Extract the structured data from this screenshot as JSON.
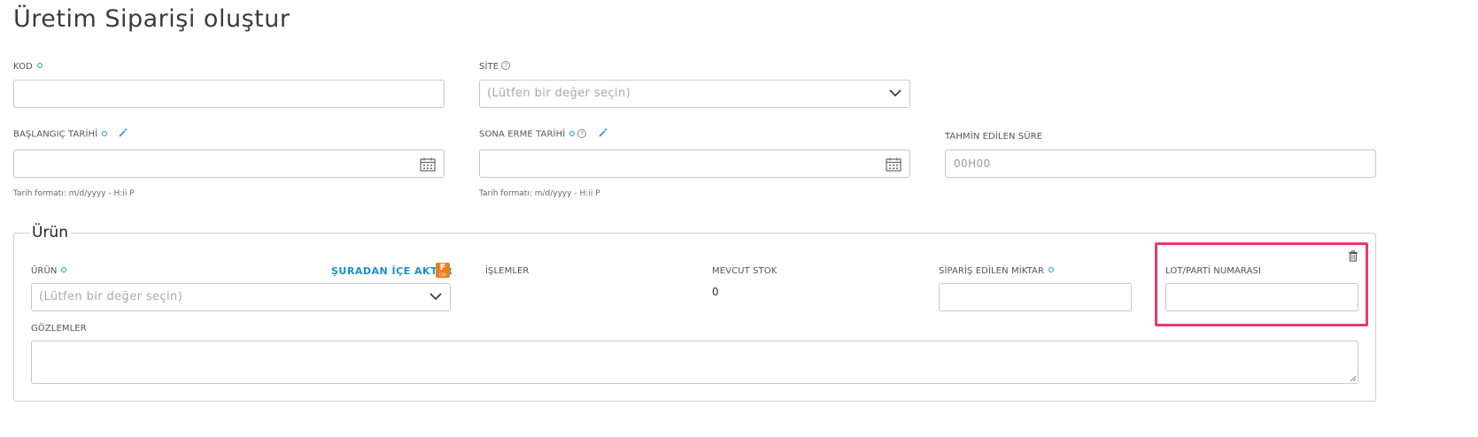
{
  "page": {
    "title": "Üretim Siparişi oluştur"
  },
  "form": {
    "kod": {
      "label": "KOD",
      "value": ""
    },
    "site": {
      "label": "SİTE",
      "placeholder": "(Lütfen bir değer seçin)"
    },
    "start_date": {
      "label": "BAŞLANGIÇ TARİHİ",
      "value": "",
      "hint": "Tarih formatı: m/d/yyyy - H:ii P"
    },
    "end_date": {
      "label": "SONA ERME TARİHİ",
      "value": "",
      "hint": "Tarih formatı: m/d/yyyy - H:ii P"
    },
    "estimated_duration": {
      "label": "TAHMİN EDİLEN SÜRE",
      "value": "00H00"
    }
  },
  "product_section": {
    "legend": "Ürün",
    "product": {
      "label": "ÜRÜN",
      "placeholder": "(Lütfen bir değer seçin)",
      "import_link": "ŞURADAN İÇE AKTAR",
      "import_icon_letter": "F",
      "import_icon_sub": "CSV"
    },
    "operations": {
      "label": "İŞLEMLER"
    },
    "stock": {
      "label": "MEVCUT STOK",
      "value": "0"
    },
    "ordered_qty": {
      "label": "SİPARİŞ EDİLEN MİKTAR",
      "value": ""
    },
    "lot": {
      "label": "LOT/PARTİ NUMARASI",
      "value": ""
    },
    "notes": {
      "label": "GÖZLEMLER",
      "value": ""
    }
  },
  "icons": {
    "required": "required-dot-icon",
    "help": "help-circle-icon",
    "wand": "magic-wand-icon",
    "calendar": "calendar-icon",
    "chevron": "chevron-down-icon",
    "delete": "trash-icon"
  },
  "colors": {
    "accent": "#1a9bd7",
    "highlight": "#e8396d",
    "import_icon": "#f07d1d"
  }
}
